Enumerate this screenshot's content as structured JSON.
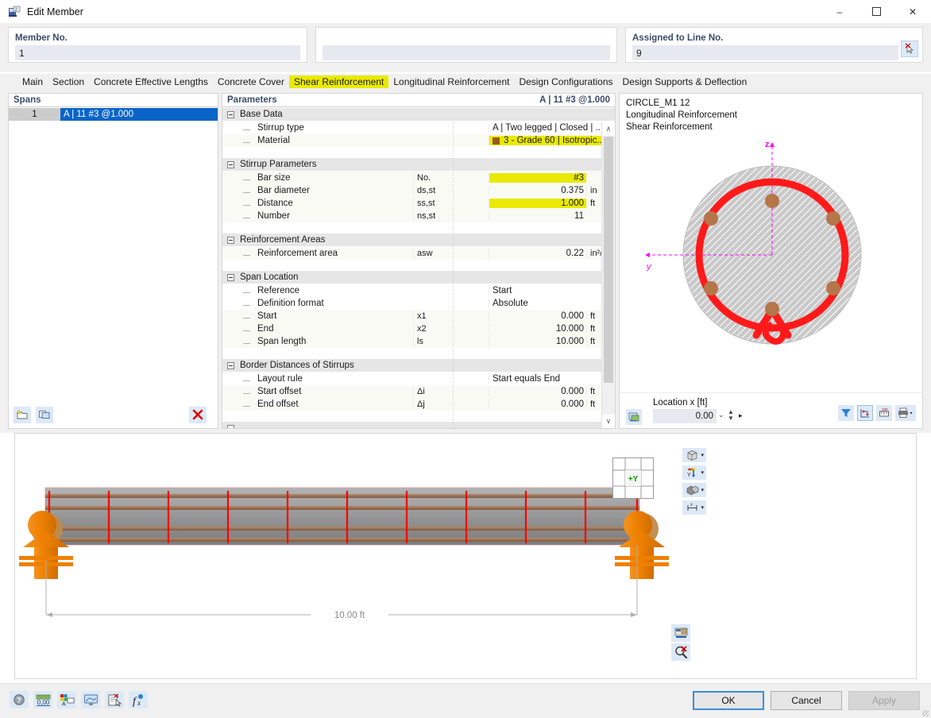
{
  "window": {
    "title": "Edit Member",
    "icon": "edit-member-icon",
    "minimize": "–",
    "maximize": "☐",
    "close": "✕"
  },
  "header": {
    "member_no_label": "Member No.",
    "member_no_value": "1",
    "middle_value": "",
    "assigned_line_label": "Assigned to Line No.",
    "assigned_line_value": "9",
    "pick_icon": "pick-line-cursor-icon"
  },
  "tabs": [
    {
      "label": "Main",
      "active": false
    },
    {
      "label": "Section",
      "active": false
    },
    {
      "label": "Concrete Effective Lengths",
      "active": false
    },
    {
      "label": "Concrete Cover",
      "active": false
    },
    {
      "label": "Shear Reinforcement",
      "active": true
    },
    {
      "label": "Longitudinal Reinforcement",
      "active": false
    },
    {
      "label": "Design Configurations",
      "active": false
    },
    {
      "label": "Design Supports & Deflection",
      "active": false
    }
  ],
  "spans": {
    "title": "Spans",
    "rows": [
      {
        "no": "1",
        "value": "A | 11 #3 @1.000",
        "selected": true
      }
    ],
    "toolbar": [
      {
        "name": "new-span-icon",
        "label": ""
      },
      {
        "name": "copy-span-icon",
        "label": ""
      },
      {
        "name": "delete-span-icon",
        "label": "✕"
      }
    ]
  },
  "parameters": {
    "title": "Parameters",
    "header_right": "A | 11 #3 @1.000",
    "groups": [
      {
        "name": "Base Data",
        "rows": [
          {
            "name": "Stirrup type",
            "symbol": "",
            "value": "A | Two legged | Closed | ...",
            "unit": "",
            "align": "text",
            "highlight": false
          },
          {
            "name": "Material",
            "symbol": "",
            "value": "3 - Grade 60 | Isotropic...",
            "unit": "",
            "align": "text",
            "highlight": true,
            "swatch": "#9a5a1e"
          }
        ]
      },
      {
        "name": "Stirrup Parameters",
        "rows": [
          {
            "name": "Bar size",
            "symbol": "No.",
            "value": "#3",
            "unit": "",
            "align": "num",
            "highlight": true
          },
          {
            "name": "Bar diameter",
            "symbol": "ds,st",
            "value": "0.375",
            "unit": "in",
            "align": "num",
            "highlight": false
          },
          {
            "name": "Distance",
            "symbol": "ss,st",
            "value": "1.000",
            "unit": "ft",
            "align": "num",
            "highlight": true
          },
          {
            "name": "Number",
            "symbol": "ns,st",
            "value": "11",
            "unit": "",
            "align": "num",
            "highlight": false
          }
        ]
      },
      {
        "name": "Reinforcement Areas",
        "rows": [
          {
            "name": "Reinforcement area",
            "symbol": "asw",
            "value": "0.22",
            "unit": "in²/ft",
            "align": "num",
            "highlight": false
          }
        ]
      },
      {
        "name": "Span Location",
        "rows": [
          {
            "name": "Reference",
            "symbol": "",
            "value": "Start",
            "unit": "",
            "align": "text",
            "highlight": false
          },
          {
            "name": "Definition format",
            "symbol": "",
            "value": "Absolute",
            "unit": "",
            "align": "text",
            "highlight": false
          },
          {
            "name": "Start",
            "symbol": "x1",
            "value": "0.000",
            "unit": "ft",
            "align": "num",
            "highlight": false
          },
          {
            "name": "End",
            "symbol": "x2",
            "value": "10.000",
            "unit": "ft",
            "align": "num",
            "highlight": false
          },
          {
            "name": "Span length",
            "symbol": "ls",
            "value": "10.000",
            "unit": "ft",
            "align": "num",
            "highlight": false
          }
        ]
      },
      {
        "name": "Border Distances of Stirrups",
        "rows": [
          {
            "name": "Layout rule",
            "symbol": "",
            "value": "Start equals End",
            "unit": "",
            "align": "text",
            "highlight": false
          },
          {
            "name": "Start offset",
            "symbol": "Δi",
            "value": "0.000",
            "unit": "ft",
            "align": "num",
            "highlight": false
          },
          {
            "name": "End offset",
            "symbol": "Δj",
            "value": "0.000",
            "unit": "ft",
            "align": "num",
            "highlight": false
          }
        ]
      }
    ],
    "scroll_up": "∧",
    "scroll_down": "∨"
  },
  "section_view": {
    "caption_lines": [
      "CIRCLE_M1 12",
      "Longitudinal Reinforcement",
      "Shear Reinforcement"
    ],
    "axis_z": "z",
    "axis_y": "y",
    "location_label": "Location x [ft]",
    "location_value": "0.00",
    "dropdown_caret": "⌄",
    "play_glyph": "▸",
    "render_icon": "render-section-icon",
    "tools": [
      {
        "name": "filter-icon",
        "glyph": "▼"
      },
      {
        "name": "dimension-lines-icon",
        "glyph": ""
      },
      {
        "name": "scale-icon",
        "glyph": ""
      },
      {
        "name": "print-icon",
        "glyph": ""
      }
    ],
    "colors": {
      "concrete": "#c8c8c8",
      "stirrup": "#ff1a1a",
      "rebar": "#b5764a",
      "axis": "#ff00ff"
    },
    "rebar_count": 6
  },
  "model_view": {
    "dimension_label": "10.00 ft",
    "nav_cube_label": "+Y",
    "view_tools": [
      {
        "name": "view-cube-icon",
        "caret": "▾"
      },
      {
        "name": "axis-direction-icon",
        "caret": "▾"
      },
      {
        "name": "render-mode-icon",
        "caret": "▾"
      },
      {
        "name": "dimension-tool-icon",
        "caret": "▾"
      }
    ],
    "corner_tools": [
      {
        "name": "render-settings-icon"
      },
      {
        "name": "zoom-reset-icon"
      }
    ],
    "colors": {
      "beam": "#9a9a9a",
      "rebar": "#9c7256",
      "stirrup": "#ff0000",
      "support": "#ee8000"
    },
    "stirrup_count": 11
  },
  "bottom": {
    "tools": [
      {
        "name": "help-icon"
      },
      {
        "name": "units-icon"
      },
      {
        "name": "display-properties-icon"
      },
      {
        "name": "graphic-settings-icon"
      },
      {
        "name": "comment-icon"
      },
      {
        "name": "formula-icon"
      }
    ],
    "ok_label": "OK",
    "cancel_label": "Cancel",
    "apply_label": "Apply"
  }
}
